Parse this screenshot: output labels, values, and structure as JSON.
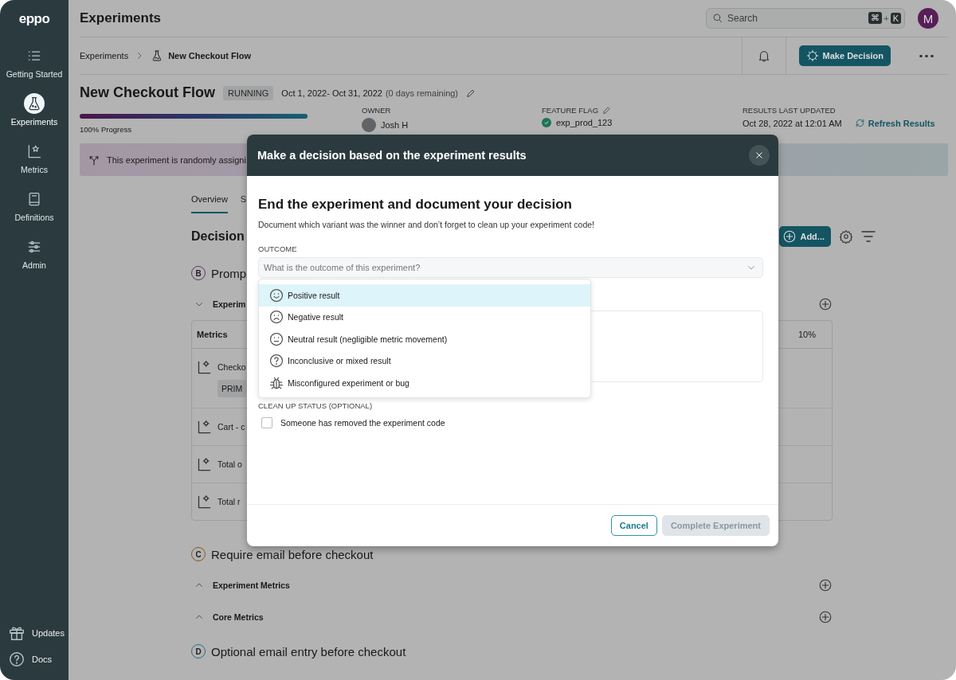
{
  "sidebar": {
    "logo": "eppo",
    "items": [
      {
        "label": "Getting Started",
        "selected": false
      },
      {
        "label": "Experiments",
        "selected": true
      },
      {
        "label": "Metrics",
        "selected": false
      },
      {
        "label": "Definitions",
        "selected": false
      },
      {
        "label": "Admin",
        "selected": false
      }
    ],
    "footer_items": [
      {
        "label": "Updates"
      },
      {
        "label": "Docs"
      }
    ]
  },
  "header": {
    "title": "Experiments",
    "search": {
      "placeholder": "Search",
      "shortcut": [
        "⌘",
        "+",
        "K"
      ]
    },
    "avatar": "M"
  },
  "breadcrumb": [
    "Experiments",
    "New Checkout Flow"
  ],
  "toolbar": {
    "primary_button": "Make Decision"
  },
  "experiment": {
    "title": "New Checkout Flow",
    "status": "RUNNING",
    "dates": "Oct 1, 2022- Oct 31, 2022",
    "remaining": "(0 days remaining)",
    "progress": {
      "level": 1,
      "label": "100% Progress"
    },
    "owner": {
      "label": "OWNER",
      "name": "Josh H"
    },
    "feature_flag": {
      "label": "FEATURE FLAG",
      "value": "exp_prod_123"
    },
    "results": {
      "label": "RESULTS LAST UPDATED",
      "value": "Oct 28, 2022 at 12:01 AM",
      "action": "Refresh Results"
    }
  },
  "banner": "This experiment is randomly assigni",
  "tabs": [
    {
      "label": "Overview",
      "selected": true
    },
    {
      "label": "S",
      "selected": false
    }
  ],
  "section": {
    "title": "Decision",
    "add_button": "Add..."
  },
  "variants": [
    {
      "letter": "B",
      "color": "#633462",
      "name": "Promp",
      "groups": [
        {
          "title": "Experim",
          "expanded": true
        }
      ],
      "table": {
        "header": "Metrics",
        "column_2": "10%",
        "rows": [
          {
            "name": "Checko",
            "tag": "PRIM"
          },
          {
            "name": "Cart - c"
          },
          {
            "name": "Total o"
          },
          {
            "name": "Total r"
          }
        ]
      }
    },
    {
      "letter": "C",
      "color": "#8b551d",
      "name": "Require email before checkout",
      "groups": [
        {
          "title": "Experiment Metrics",
          "expanded": false
        },
        {
          "title": "Core Metrics",
          "expanded": false
        }
      ]
    },
    {
      "letter": "D",
      "color": "#296d89",
      "name": "Optional email entry before checkout"
    }
  ],
  "modal": {
    "title": "Make a decision based on the experiment results",
    "heading": "End the experiment and document your decision",
    "description": "Document which variant was the winner and don’t forget to clean up your experiment code!",
    "outcome": {
      "label": "OUTCOME",
      "placeholder": "What is the outcome of this experiment?",
      "expanded": true,
      "options": [
        {
          "label": "Positive result",
          "selected": true
        },
        {
          "label": "Negative result",
          "selected": false
        },
        {
          "label": "Neutral result (negligible metric movement)",
          "selected": false
        },
        {
          "label": "Inconclusive or mixed result",
          "selected": false
        },
        {
          "label": "Misconfigured experiment or bug",
          "selected": false
        }
      ]
    },
    "cleanup": {
      "label": "CLEAN UP STATUS (OPTIONAL)",
      "checkbox": {
        "label": "Someone has removed the experiment code",
        "checked": false
      }
    },
    "buttons": [
      {
        "label": "Cancel",
        "kind": "secondary"
      },
      {
        "label": "Complete Experiment",
        "kind": "primary",
        "disabled": true
      }
    ]
  }
}
